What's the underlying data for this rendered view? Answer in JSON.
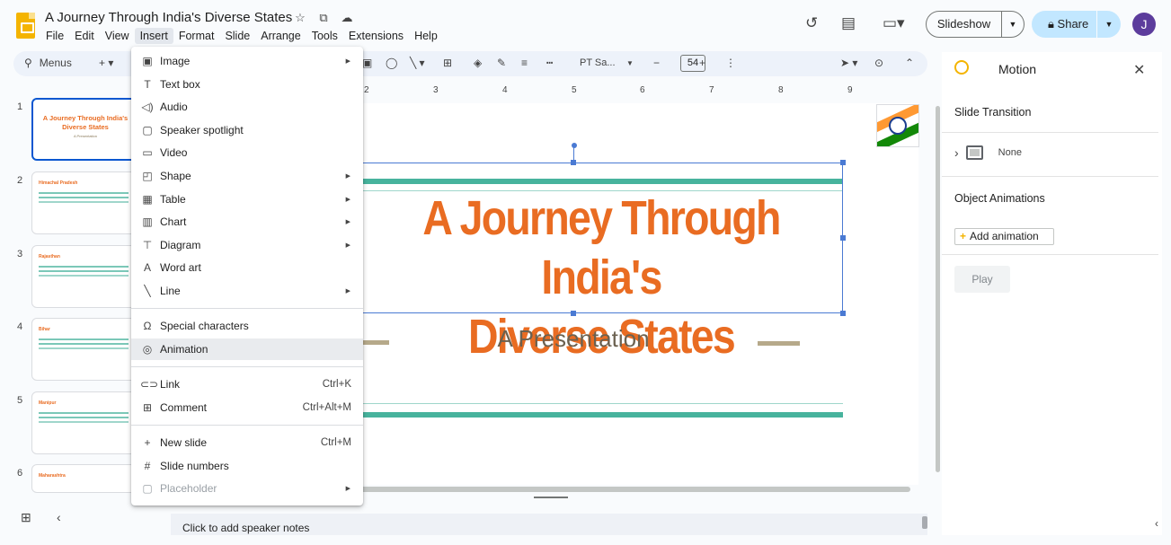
{
  "header": {
    "title": "A Journey Through India's Diverse States",
    "menus": [
      "File",
      "Edit",
      "View",
      "Insert",
      "Format",
      "Slide",
      "Arrange",
      "Tools",
      "Extensions",
      "Help"
    ],
    "slideshow_label": "Slideshow",
    "share_label": "Share",
    "avatar_initial": "J"
  },
  "toolbar": {
    "search_label": "Menus",
    "font_name": "PT Sa...",
    "font_size": "54"
  },
  "ruler": [
    "2",
    "3",
    "4",
    "5",
    "6",
    "7",
    "8",
    "9"
  ],
  "filmstrip": [
    {
      "num": "1",
      "title": "A Journey Through India's Diverse States",
      "subtitle": "A Presentation"
    },
    {
      "num": "2",
      "title": "Himachal Pradesh"
    },
    {
      "num": "3",
      "title": "Rajasthan"
    },
    {
      "num": "4",
      "title": "Bihar"
    },
    {
      "num": "5",
      "title": "Manipur"
    },
    {
      "num": "6",
      "title": "Maharashtra"
    }
  ],
  "slide": {
    "title_line1": "A Journey Through India's",
    "title_line2": "Diverse States",
    "subtitle": "A Presentation"
  },
  "notes_placeholder": "Click to add speaker notes",
  "panel": {
    "title": "Motion",
    "slide_transition": "Slide Transition",
    "transition_value": "None",
    "object_animations": "Object Animations",
    "add_animation": "Add animation",
    "play": "Play"
  },
  "insert_menu": {
    "items": [
      {
        "label": "Image",
        "icon": "image-icon",
        "submenu": true
      },
      {
        "label": "Text box",
        "icon": "text-box-icon"
      },
      {
        "label": "Audio",
        "icon": "audio-icon"
      },
      {
        "label": "Speaker spotlight",
        "icon": "speaker-spotlight-icon"
      },
      {
        "label": "Video",
        "icon": "video-icon"
      },
      {
        "label": "Shape",
        "icon": "shape-icon",
        "submenu": true
      },
      {
        "label": "Table",
        "icon": "table-icon",
        "submenu": true
      },
      {
        "label": "Chart",
        "icon": "chart-icon",
        "submenu": true
      },
      {
        "label": "Diagram",
        "icon": "diagram-icon",
        "submenu": true
      },
      {
        "label": "Word art",
        "icon": "word-art-icon"
      },
      {
        "label": "Line",
        "icon": "line-icon",
        "submenu": true
      },
      {
        "label": "Special characters",
        "icon": "omega-icon"
      },
      {
        "label": "Animation",
        "icon": "animation-icon"
      },
      {
        "label": "Link",
        "icon": "link-icon",
        "shortcut": "Ctrl+K"
      },
      {
        "label": "Comment",
        "icon": "comment-icon",
        "shortcut": "Ctrl+Alt+M"
      },
      {
        "label": "New slide",
        "icon": "plus-icon",
        "shortcut": "Ctrl+M"
      },
      {
        "label": "Slide numbers",
        "icon": "hash-icon"
      },
      {
        "label": "Placeholder",
        "icon": "placeholder-icon",
        "submenu": true,
        "disabled": true
      }
    ]
  },
  "colors": {
    "accent_orange": "#e96c22",
    "teal": "#47b39d",
    "selection_blue": "#4a7ad3",
    "share_bg": "#c2e7ff",
    "avatar_bg": "#5c3c9c"
  }
}
